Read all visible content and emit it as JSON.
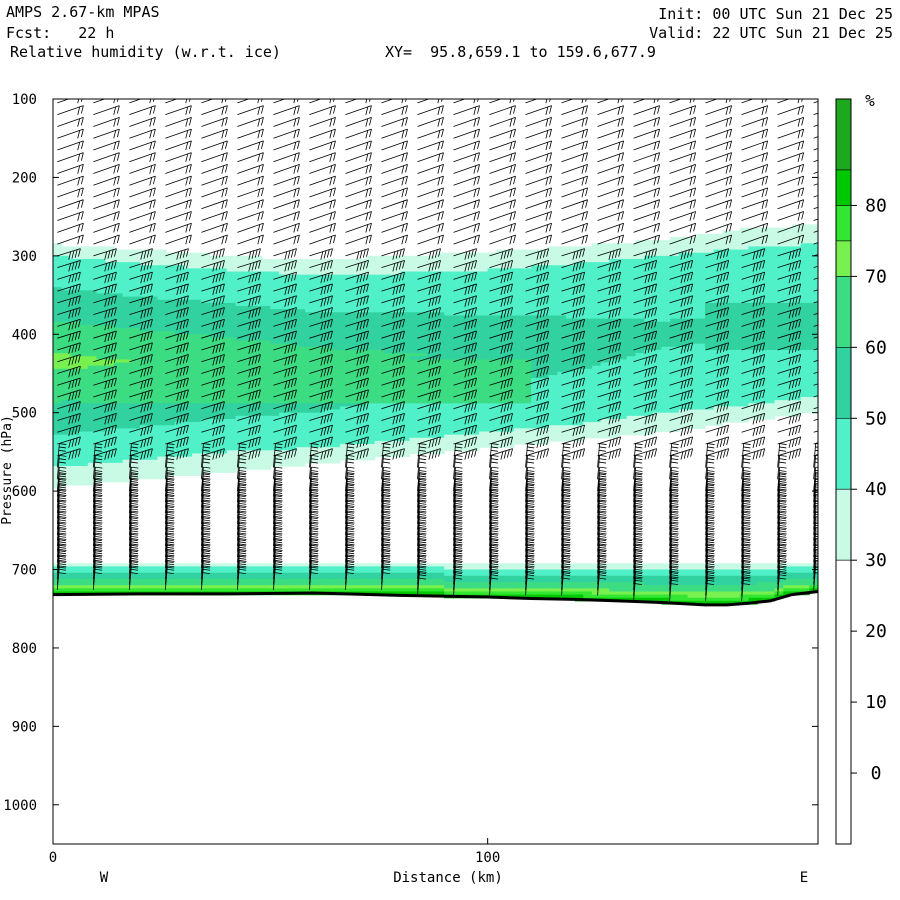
{
  "header": {
    "model": "AMPS 2.67-km MPAS",
    "fcst": "Fcst:   22 h",
    "field": "Relative humidity (w.r.t. ice)",
    "xy": "XY=  95.8,659.1 to 159.6,677.9",
    "init": "Init: 00 UTC Sun 21 Dec 25",
    "valid": "Valid: 22 UTC Sun 21 Dec 25"
  },
  "chart_data": {
    "type": "heatmap",
    "title": "Relative humidity (w.r.t. ice)",
    "xlabel": "Distance (km)",
    "ylabel": "Pressure (hPa)",
    "xlim": [
      0,
      176
    ],
    "ylim": [
      1050,
      100
    ],
    "x_ticks": [
      0,
      100
    ],
    "y_ticks": [
      100,
      200,
      300,
      400,
      500,
      600,
      700,
      800,
      900,
      1000
    ],
    "left_end_label": "W",
    "right_end_label": "E",
    "colorbar": {
      "unit": "%",
      "tick_labels": [
        "80",
        "70",
        "60",
        "50",
        "40",
        "30",
        "20",
        "10",
        "0"
      ],
      "bands": [
        {
          "from": 85,
          "to": 95,
          "color": "#1ea81e"
        },
        {
          "from": 80,
          "to": 85,
          "color": "#00c800"
        },
        {
          "from": 75,
          "to": 80,
          "color": "#32e632"
        },
        {
          "from": 70,
          "to": 75,
          "color": "#78f050"
        },
        {
          "from": 60,
          "to": 70,
          "color": "#3cdc82"
        },
        {
          "from": 50,
          "to": 60,
          "color": "#32d2a0"
        },
        {
          "from": 40,
          "to": 50,
          "color": "#50f0c8"
        },
        {
          "from": 30,
          "to": 40,
          "color": "#c8fae6"
        },
        {
          "from": -10,
          "to": 30,
          "color": "#ffffff"
        }
      ]
    },
    "upper_moist_layer": {
      "x_km": [
        0,
        20,
        40,
        60,
        80,
        100,
        120,
        140,
        160,
        176
      ],
      "top_30_hPa": [
        285,
        292,
        300,
        305,
        300,
        295,
        288,
        280,
        265,
        260
      ],
      "top_40_hPa": [
        300,
        310,
        318,
        325,
        322,
        318,
        310,
        300,
        290,
        285
      ],
      "bottom_40_hPa": [
        570,
        560,
        550,
        545,
        535,
        525,
        515,
        500,
        490,
        480
      ],
      "bottom_30_hPa": [
        595,
        585,
        575,
        565,
        555,
        545,
        535,
        525,
        510,
        500
      ],
      "rh_core_max": 65
    },
    "near_surface_layer": {
      "top_30_hPa": 690,
      "peak_rh": 85
    },
    "terrain_surface_hPa": {
      "x_km": [
        0,
        20,
        40,
        60,
        80,
        100,
        110,
        120,
        130,
        140,
        150,
        155,
        160,
        165,
        170,
        176
      ],
      "pressure": [
        732,
        731,
        731,
        730,
        733,
        735,
        737,
        738,
        740,
        742,
        745,
        745,
        743,
        740,
        732,
        728
      ]
    },
    "wind_barb_columns": 22
  }
}
